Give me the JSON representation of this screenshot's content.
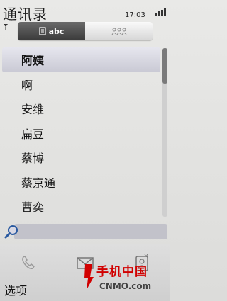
{
  "app": {
    "title": "通讯录",
    "clock": "17:03"
  },
  "tabs": [
    {
      "label": "abc",
      "icon": "alphabet-list-icon",
      "active": true
    },
    {
      "label": "",
      "icon": "groups-icon",
      "active": false
    }
  ],
  "contacts": [
    {
      "name": "阿姨",
      "selected": true
    },
    {
      "name": "啊"
    },
    {
      "name": "安维"
    },
    {
      "name": "扁豆"
    },
    {
      "name": "蔡博"
    },
    {
      "name": "蔡京通"
    },
    {
      "name": "曹奕"
    }
  ],
  "scroll": {
    "position": 0.0
  },
  "search": {
    "placeholder": "",
    "icon": "search-icon"
  },
  "toolbar": {
    "options_label": "选项",
    "call_icon": "phone-icon",
    "message_icon": "envelope-icon",
    "new_contact_icon": "new-contact-icon"
  },
  "watermark": {
    "text": "手机中国",
    "sub": "CNMO.com"
  },
  "colors": {
    "selected_row": "#d2d2dc",
    "search_field": "#c2c2ca",
    "watermark_red": "#d10000"
  }
}
